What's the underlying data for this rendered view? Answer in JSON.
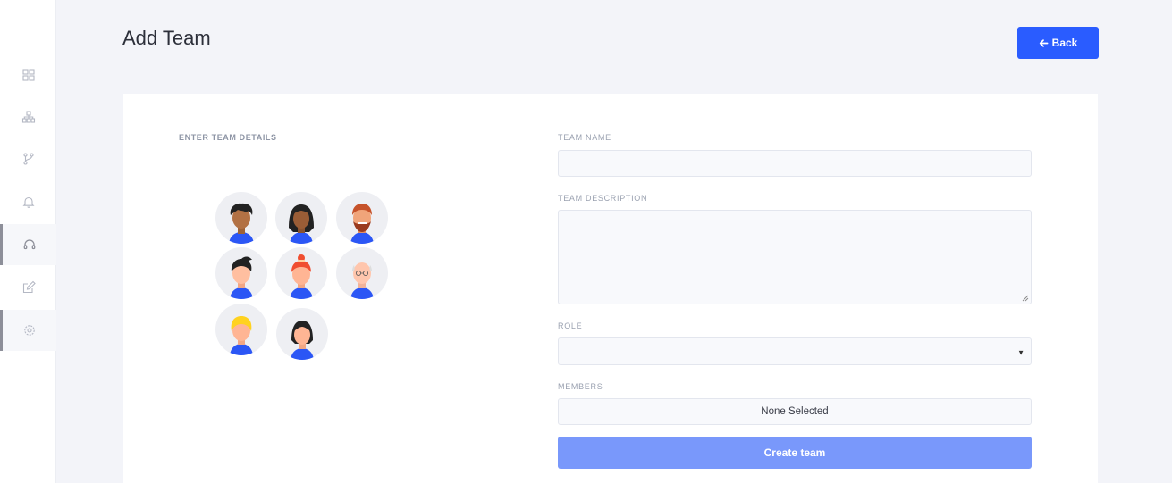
{
  "sidebar": {
    "items": [
      {
        "icon": "grid-icon"
      },
      {
        "icon": "hierarchy-icon"
      },
      {
        "icon": "branch-icon"
      },
      {
        "icon": "bell-icon"
      },
      {
        "icon": "headset-icon"
      },
      {
        "icon": "edit-icon"
      },
      {
        "icon": "settings-icon"
      }
    ]
  },
  "header": {
    "title": "Add Team",
    "back_label": "Back",
    "back_color": "#2a5cff"
  },
  "form": {
    "section_label": "ENTER TEAM DETAILS",
    "team_name_label": "TEAM NAME",
    "team_name_value": "",
    "team_description_label": "TEAM DESCRIPTION",
    "team_description_value": "",
    "role_label": "ROLE",
    "role_value": "",
    "members_label": "MEMBERS",
    "members_value": "None Selected",
    "submit_label": "Create team",
    "submit_color": "#7998fb"
  },
  "illustration": {
    "avatars": [
      "avatar-1",
      "avatar-2",
      "avatar-3",
      "avatar-4",
      "avatar-5",
      "avatar-6",
      "avatar-7",
      "avatar-8"
    ]
  }
}
